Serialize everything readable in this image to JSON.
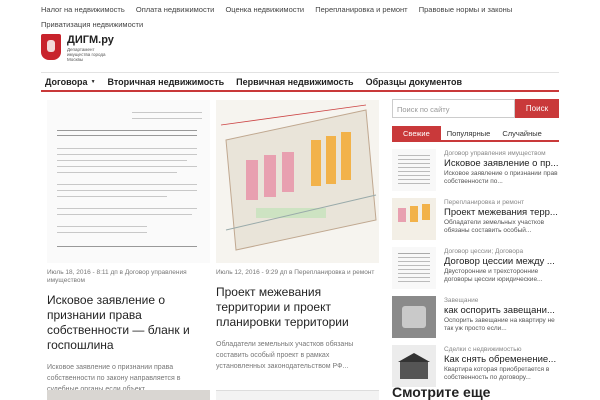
{
  "top_nav": [
    "Налог на недвижимость",
    "Оплата недвижимости",
    "Оценка недвижимости",
    "Перепланировка и ремонт",
    "Правовые нормы и законы",
    "Приватизация недвижимости"
  ],
  "logo": {
    "title": "ДИГМ.ру",
    "subtitle": "Департамент имущества города Москвы"
  },
  "main_nav": [
    "Договора",
    "Вторичная недвижимость",
    "Первичная недвижимость",
    "Образцы документов"
  ],
  "cards": [
    {
      "meta": "Июль 18, 2016 - 8:11 дп в Договор управления имуществом",
      "title": "Исковое заявление о признании права собственности — бланк и госпошлина",
      "excerpt": "Исковое заявление о признании права собственности по закону направляется в судебные органы если объект..."
    },
    {
      "meta": "Июль 12, 2016 - 9:29 дп в Перепланировка и ремонт",
      "title": "Проект межевания территории и проект планировки территории",
      "excerpt": "Обладатели земельных участков обязаны составить особый проект в рамках установленных законодательством РФ..."
    }
  ],
  "sidebar": {
    "search_placeholder": "Поиск по сайту",
    "search_button": "Поиск",
    "tabs": [
      "Свежие",
      "Популярные",
      "Случайные"
    ],
    "items": [
      {
        "category": "Договор управления имуществом",
        "title": "Исковое заявление о пр...",
        "excerpt": "Исковое заявление о признании прав собственности по..."
      },
      {
        "category": "Перепланировка и ремонт",
        "title": "Проект межевания терр...",
        "excerpt": "Обладатели земельных участков обязаны составить особый..."
      },
      {
        "category": "Договор цессии; Договора",
        "title": "Договор цессии между ...",
        "excerpt": "Двусторонние и трехсторонние договоры цессии юридические..."
      },
      {
        "category": "Завещание",
        "title": "как оспорить завещани...",
        "excerpt": "Оспорить завещание на квартиру не так уж просто если..."
      },
      {
        "category": "Сделки с недвижимостью",
        "title": "Как снять обременение...",
        "excerpt": "Квартира которая приобретается в собственность по договору..."
      }
    ],
    "see_more": "Смотрите еще"
  }
}
